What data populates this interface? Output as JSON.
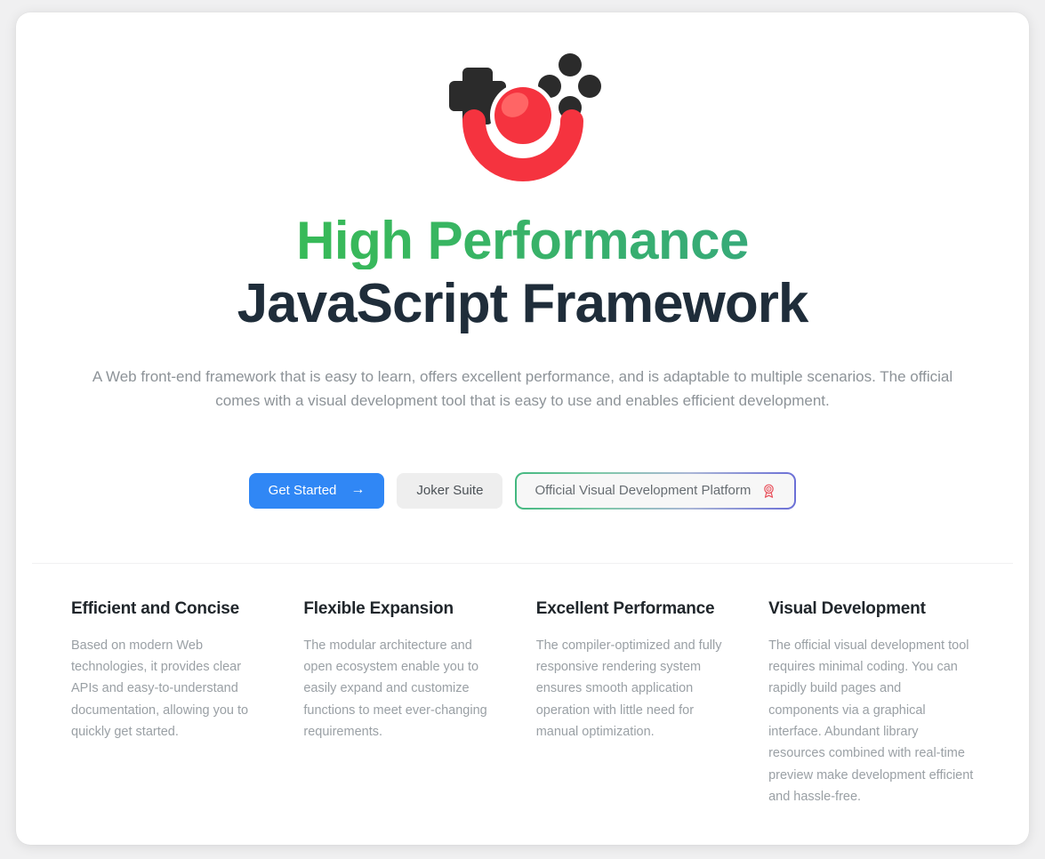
{
  "brand": {
    "logo_icon": "joker-clown-face-logo",
    "logo_colors": {
      "face": "#f5333f",
      "dots": "#2b2b2b",
      "nose_highlight": "#ff6b6b"
    }
  },
  "hero": {
    "headline_accent": "High Performance",
    "headline_main": "JavaScript Framework",
    "accent_gradient_from": "#34c24a",
    "accent_gradient_to": "#37a383",
    "headline_color": "#1f2d3a",
    "subtitle": "A Web front-end framework that is easy to learn, offers excellent performance, and is adaptable to multiple scenarios. The official comes with a visual development tool that is easy to use and enables efficient development."
  },
  "cta": {
    "primary": {
      "label": "Get Started",
      "arrow_glyph": "→",
      "background": "#3087f5",
      "text_color": "#ffffff"
    },
    "secondary": {
      "label": "Joker Suite",
      "background": "#eeeeee",
      "text_color": "#4c5257"
    },
    "tertiary": {
      "label": "Official Visual Development Platform",
      "icon": "medal-award-icon",
      "icon_color": "#e8505b",
      "border_gradient_from": "#43b87f",
      "border_gradient_to": "#6b6fd6",
      "background": "#f7f7f7",
      "text_color": "#676d72"
    }
  },
  "features": [
    {
      "title": "Efficient and Concise",
      "text": "Based on modern Web technologies, it provides clear APIs and easy-to-understand documentation, allowing you to quickly get started."
    },
    {
      "title": "Flexible Expansion",
      "text": "The modular architecture and open ecosystem enable you to easily expand and customize functions to meet ever-changing requirements."
    },
    {
      "title": "Excellent Performance",
      "text": "The compiler-optimized and fully responsive rendering system ensures smooth application operation with little need for manual optimization."
    },
    {
      "title": "Visual Development",
      "text": "The official visual development tool requires minimal coding. You can rapidly build pages and components via a graphical interface. Abundant library resources combined with real-time preview make development efficient and hassle-free."
    }
  ]
}
